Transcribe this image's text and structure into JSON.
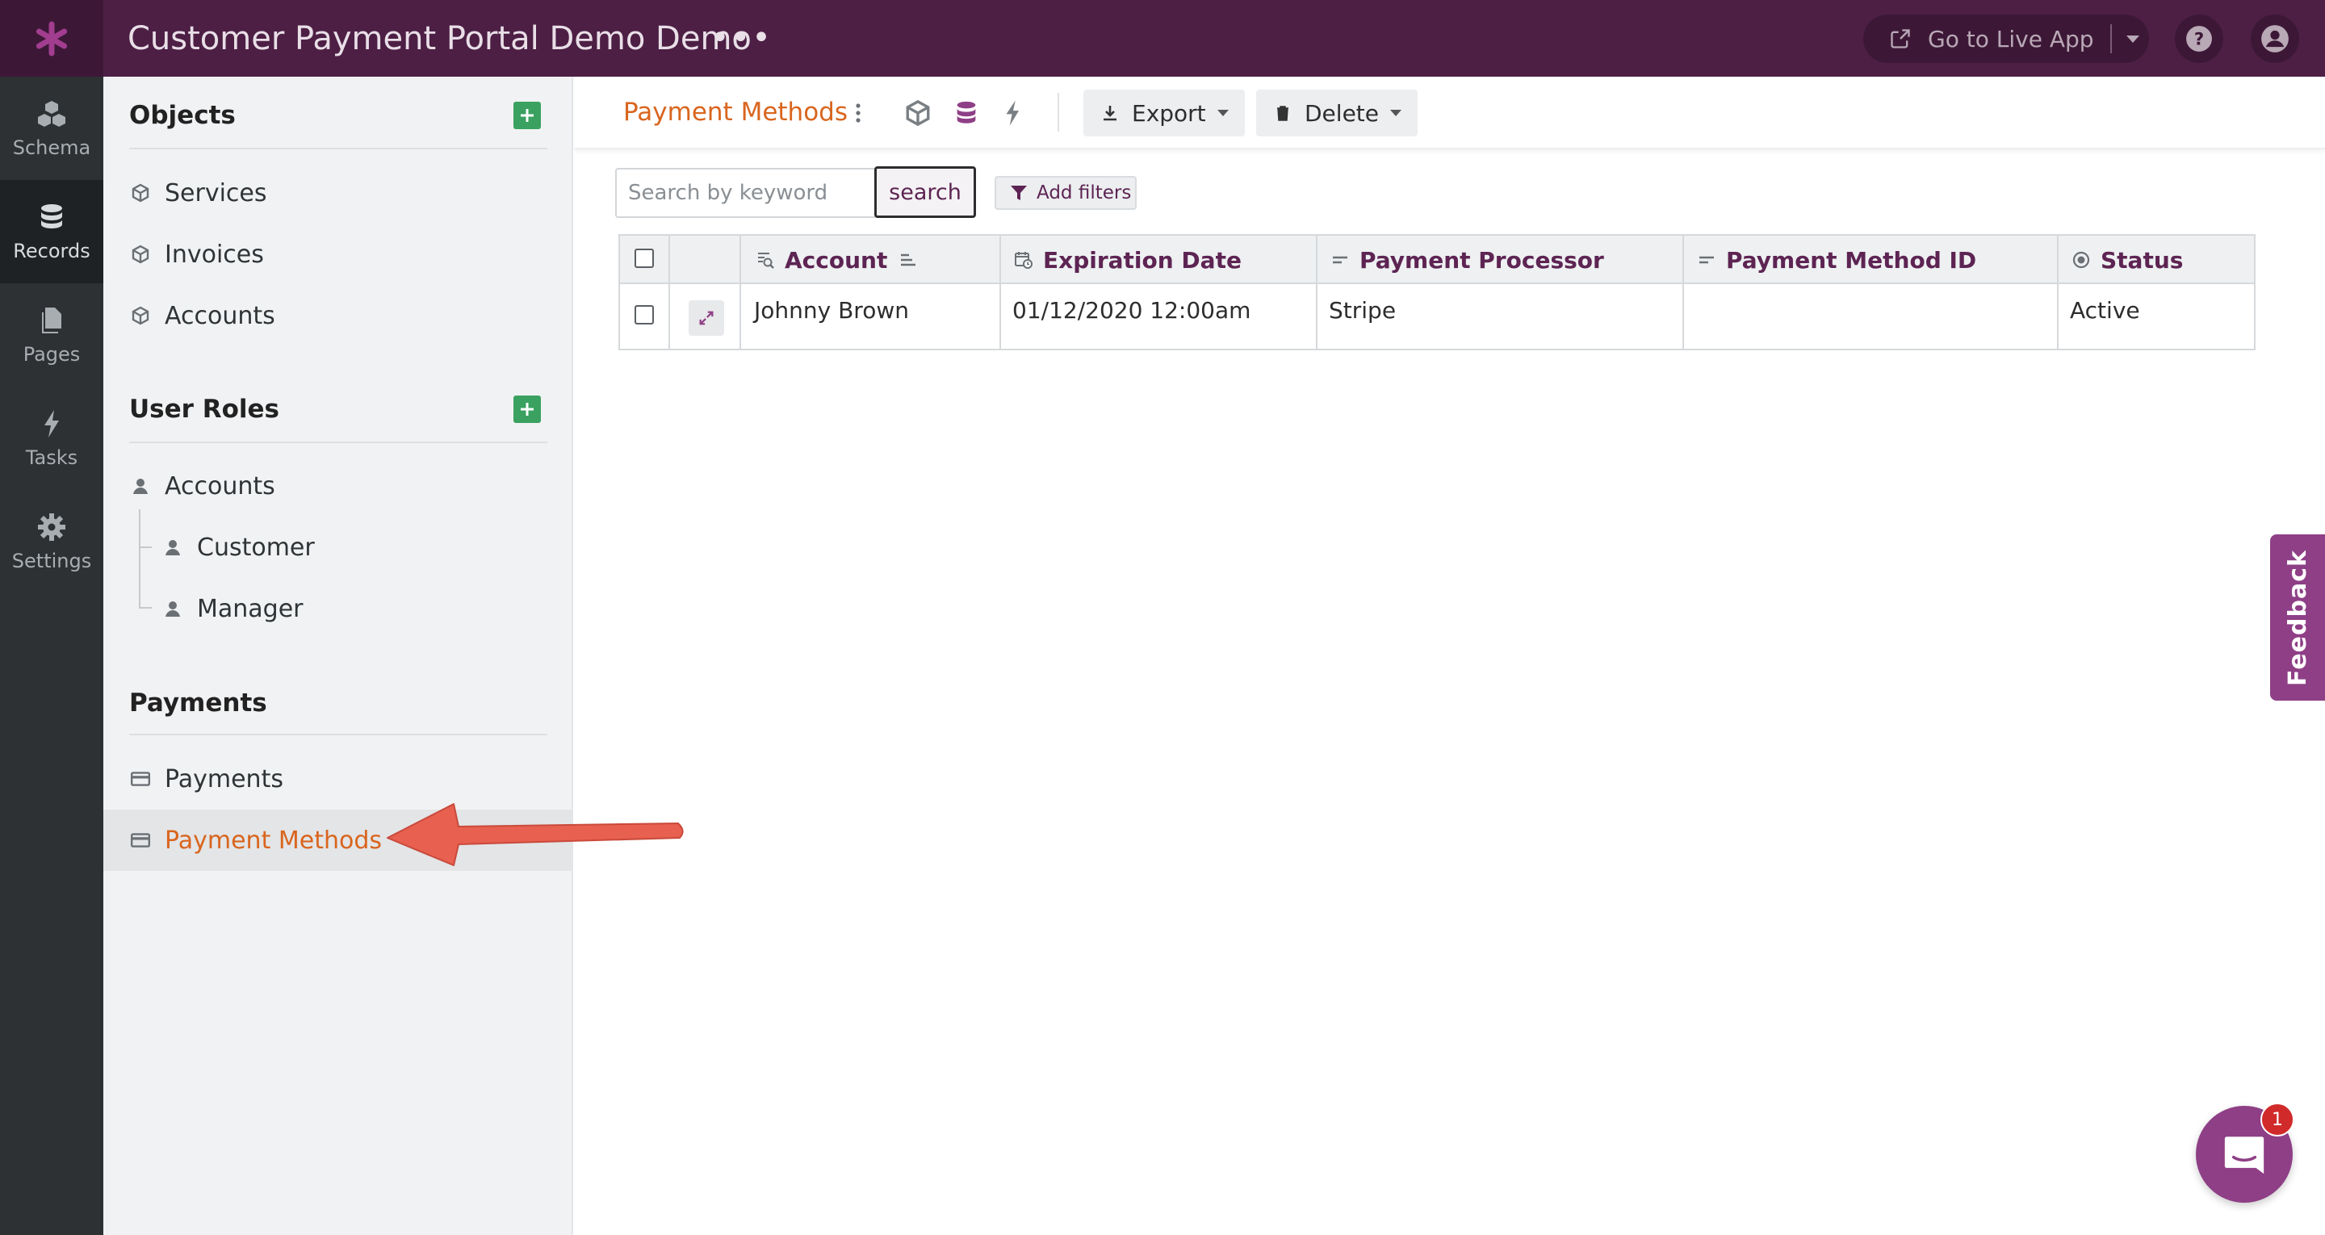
{
  "app": {
    "title": "Customer Payment Portal Demo Demo",
    "more": "•••",
    "live_button": "Go to Live App"
  },
  "rail": {
    "items": [
      {
        "label": "Schema",
        "icon": "schema-cubes-icon"
      },
      {
        "label": "Records",
        "icon": "database-icon",
        "active": true
      },
      {
        "label": "Pages",
        "icon": "pages-icon"
      },
      {
        "label": "Tasks",
        "icon": "lightning-icon"
      },
      {
        "label": "Settings",
        "icon": "gear-icon"
      }
    ]
  },
  "sidebar": {
    "objects": {
      "title": "Objects",
      "items": [
        "Services",
        "Invoices",
        "Accounts"
      ]
    },
    "user_roles": {
      "title": "User Roles",
      "items": [
        "Accounts",
        "Customer",
        "Manager"
      ]
    },
    "payments": {
      "title": "Payments",
      "items": [
        "Payments",
        "Payment Methods"
      ],
      "active": "Payment Methods"
    }
  },
  "toolbar": {
    "title": "Payment Methods",
    "export_label": "Export",
    "delete_label": "Delete"
  },
  "search": {
    "placeholder": "Search by keyword",
    "button": "search",
    "filters": "Add filters"
  },
  "table": {
    "headers": [
      "Account",
      "Expiration Date",
      "Payment Processor",
      "Payment Method ID",
      "Status"
    ],
    "rows": [
      {
        "account": "Johnny Brown",
        "expiration": "01/12/2020 12:00am",
        "processor": "Stripe",
        "method_id": "",
        "status": "Active"
      }
    ]
  },
  "feedback": "Feedback",
  "chat": {
    "badge": "1"
  },
  "colors": {
    "topbar": "#4d1f45",
    "accent_orange": "#d9651e",
    "purple": "#5d2453",
    "arrow": "#e8604f"
  }
}
